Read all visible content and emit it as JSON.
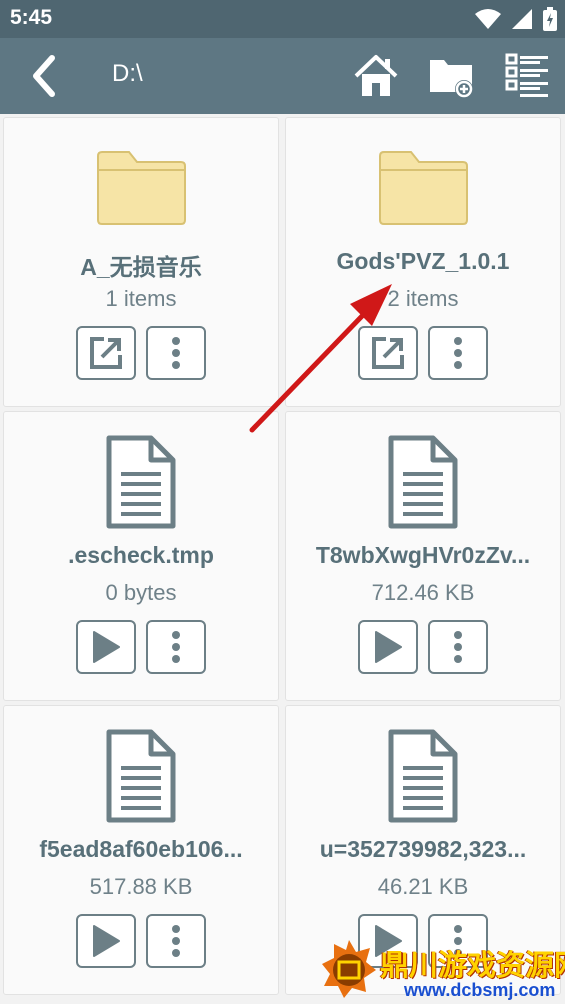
{
  "status_bar": {
    "time": "5:45",
    "icons": [
      "wifi-icon",
      "cell-signal-icon",
      "battery-icon"
    ]
  },
  "toolbar": {
    "path": "D:\\",
    "icons": [
      "back-icon",
      "home-icon",
      "new-folder-icon",
      "view-list-icon"
    ]
  },
  "files": [
    {
      "name": "A_无损音乐",
      "meta": "1 items",
      "type": "folder"
    },
    {
      "name": "Gods'PVZ_1.0.1",
      "meta": "2 items",
      "type": "folder"
    },
    {
      "name": ".escheck.tmp",
      "meta": "0 bytes",
      "type": "file"
    },
    {
      "name": "T8wbXwgHVr0zZv...",
      "meta": "712.46 KB",
      "type": "file"
    },
    {
      "name": "f5ead8af60eb106...",
      "meta": "517.88 KB",
      "type": "file"
    },
    {
      "name": "u=352739982,323...",
      "meta": "46.21 KB",
      "type": "file"
    }
  ],
  "watermark": {
    "title": "鼎川游戏资源网",
    "url": "www.dcbsmj.com"
  },
  "colors": {
    "toolbar": "#5e7783",
    "status_bar": "#4f6671",
    "folder": "#f6e4a6",
    "accent_text": "#587079"
  }
}
